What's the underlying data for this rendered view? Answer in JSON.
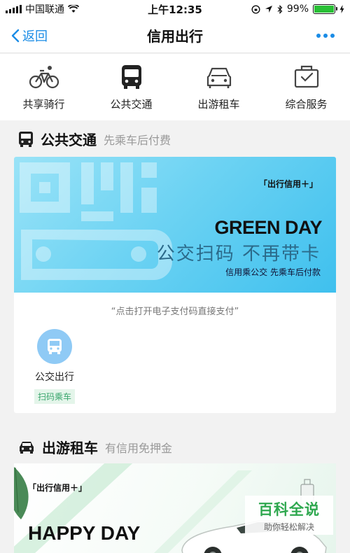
{
  "status_bar": {
    "carrier": "中国联通",
    "time": "上午12:35",
    "battery": "99%",
    "battery_level": 0.99
  },
  "nav": {
    "back_label": "返回",
    "title": "信用出行"
  },
  "tabs": [
    {
      "label": "共享骑行",
      "icon": "bicycle-icon"
    },
    {
      "label": "公共交通",
      "icon": "bus-icon"
    },
    {
      "label": "出游租车",
      "icon": "car-icon"
    },
    {
      "label": "综合服务",
      "icon": "services-icon"
    }
  ],
  "transit_section": {
    "title": "公共交通",
    "subtitle": "先乘车后付费",
    "banner": {
      "badge": "「出行信用＋」",
      "title": "GREEN DAY",
      "slogan": "公交扫码 不再带卡",
      "caption": "信用乘公交 先乘车后付款"
    },
    "hint": "“点击打开电子支付码直接支付”",
    "service": {
      "label": "公交出行",
      "tag": "扫码乘车",
      "icon": "bus-icon"
    }
  },
  "rental_section": {
    "title": "出游租车",
    "subtitle": "有信用免押金",
    "banner": {
      "badge": "「出行信用＋」",
      "title": "HAPPY DAY"
    }
  },
  "watermark": {
    "main": "百科全说",
    "sub": "助你轻松解决"
  },
  "colors": {
    "accent": "#1a8ce6",
    "banner_blue": "#6dd3f3",
    "tag_green": "#3aa66d"
  }
}
